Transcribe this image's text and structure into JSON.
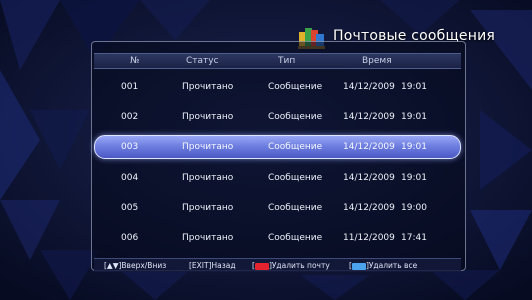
{
  "screen": {
    "title": "Почтовые сообщения"
  },
  "table": {
    "headers": {
      "num": "№",
      "status": "Статус",
      "type": "Тип",
      "time": "Время"
    },
    "rows": [
      {
        "num": "001",
        "status": "Прочитано",
        "type": "Сообщение",
        "date": "14/12/2009",
        "time": "19:01",
        "selected": false
      },
      {
        "num": "002",
        "status": "Прочитано",
        "type": "Сообщение",
        "date": "14/12/2009",
        "time": "19:01",
        "selected": false
      },
      {
        "num": "003",
        "status": "Прочитано",
        "type": "Сообщение",
        "date": "14/12/2009",
        "time": "19:01",
        "selected": true
      },
      {
        "num": "004",
        "status": "Прочитано",
        "type": "Сообщение",
        "date": "14/12/2009",
        "time": "19:01",
        "selected": false
      },
      {
        "num": "005",
        "status": "Прочитано",
        "type": "Сообщение",
        "date": "14/12/2009",
        "time": "19:00",
        "selected": false
      },
      {
        "num": "006",
        "status": "Прочитано",
        "type": "Сообщение",
        "date": "11/12/2009",
        "time": "17:41",
        "selected": false
      }
    ]
  },
  "help": {
    "nav": "[▲▼]Вверх/Вниз",
    "exit": "[EXIT]Назад",
    "red_bracket": "[",
    "red_label": "]Удалить почту",
    "blue_bracket": "[",
    "blue_label": "]Удалить все"
  },
  "colors": {
    "selected_row": "#6f7fe0",
    "red_key": "#e3232e",
    "blue_key": "#4ba3ee"
  },
  "icons": {
    "title": "mail-folder-icon"
  }
}
